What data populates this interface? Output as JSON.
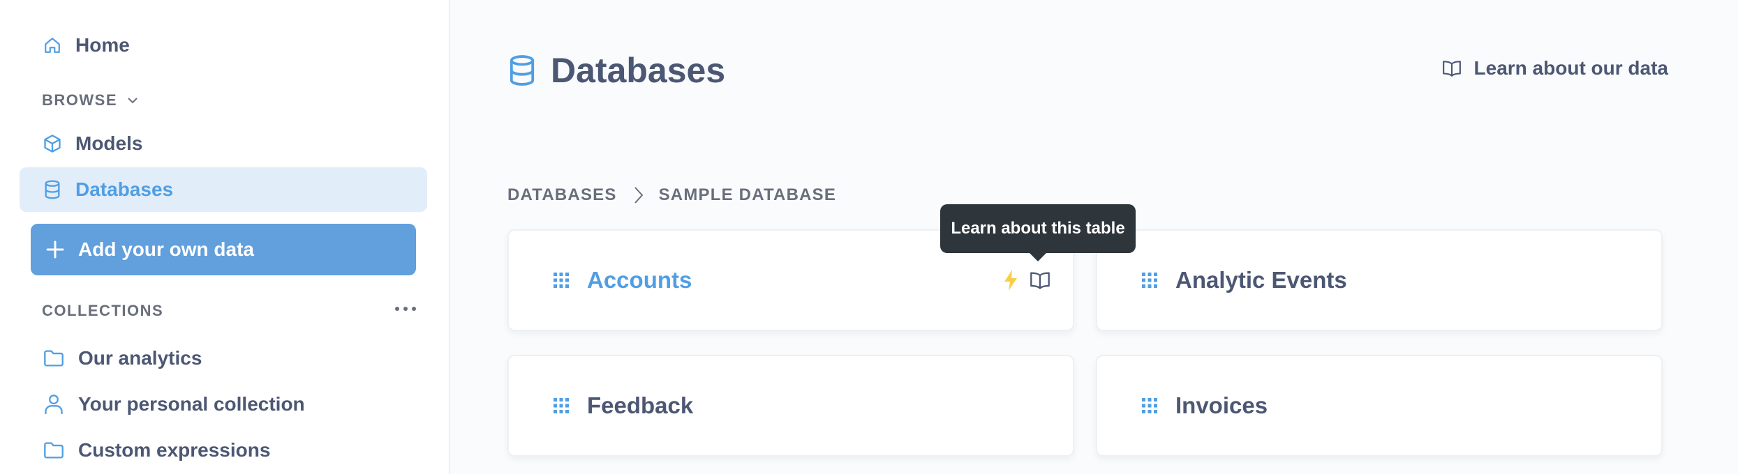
{
  "sidebar": {
    "home_label": "Home",
    "browse_label": "BROWSE",
    "models_label": "Models",
    "databases_label": "Databases",
    "add_data_label": "Add your own data",
    "collections_label": "COLLECTIONS",
    "collections": [
      {
        "label": "Our analytics",
        "icon": "folder-icon"
      },
      {
        "label": "Your personal collection",
        "icon": "person-icon"
      },
      {
        "label": "Custom expressions",
        "icon": "folder-icon"
      }
    ]
  },
  "header": {
    "title": "Databases",
    "learn_link": "Learn about our data"
  },
  "breadcrumb": {
    "items": [
      "DATABASES",
      "SAMPLE DATABASE"
    ]
  },
  "tables": [
    {
      "name": "Accounts"
    },
    {
      "name": "Analytic Events"
    },
    {
      "name": "Feedback"
    },
    {
      "name": "Invoices"
    }
  ],
  "tooltip": {
    "text": "Learn about this table"
  },
  "colors": {
    "brand": "#509ee3",
    "active_bg": "#e1edf8",
    "button_bg": "#619fdd",
    "text": "#4c5773",
    "tooltip_bg": "#2e353b",
    "xray_icon": "#f9cf48"
  }
}
